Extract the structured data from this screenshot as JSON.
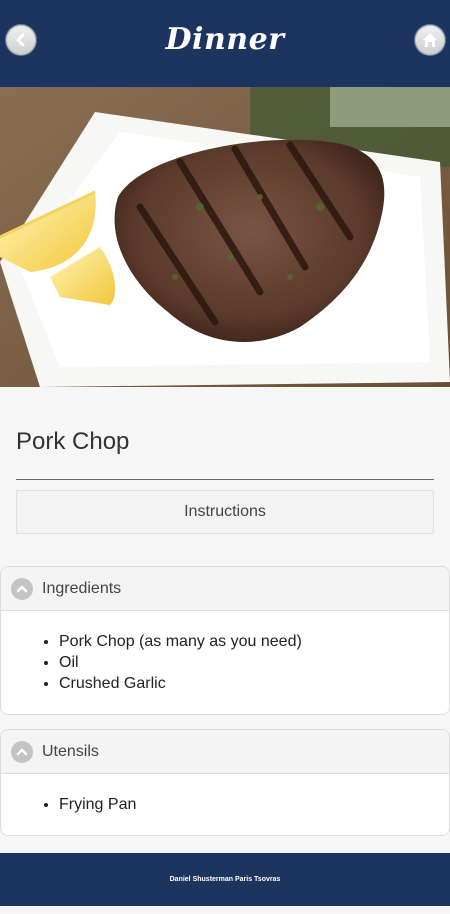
{
  "header": {
    "title": "Dinner",
    "back_icon": "chevron-left-icon",
    "home_icon": "home-icon"
  },
  "recipe": {
    "title": "Pork Chop",
    "instructions_label": "Instructions"
  },
  "ingredients": {
    "label": "Ingredients",
    "icon": "chevron-up-icon",
    "items": [
      "Pork Chop (as many as you need)",
      "Oil",
      "Crushed Garlic"
    ]
  },
  "utensils": {
    "label": "Utensils",
    "icon": "chevron-up-icon",
    "items": [
      "Frying Pan"
    ]
  },
  "footer": {
    "text": "Daniel Shusterman Paris Tsovras"
  },
  "colors": {
    "header_bg": "#1d3461",
    "page_bg": "#f6f6f6"
  }
}
